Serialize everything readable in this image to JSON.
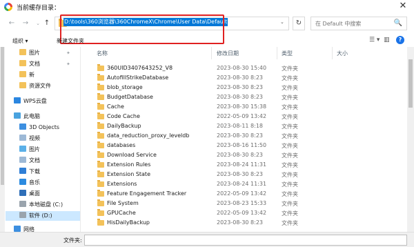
{
  "window": {
    "title": "当前缓存目录：",
    "close_glyph": "✕"
  },
  "nav": {
    "back_glyph": "←",
    "forward_glyph": "→",
    "dropdown_glyph": "⌄",
    "up_glyph": "↑",
    "refresh_glyph": "↻"
  },
  "address": {
    "path": "D:\\tools\\360浏览器\\360ChromeX\\Chrome\\User Data\\Default",
    "dropdown_glyph": "⌄"
  },
  "search": {
    "placeholder": "在 Default 中搜索",
    "icon_glyph": "🔍"
  },
  "toolbar": {
    "organize_label": "组织 ▾",
    "new_folder_label": "新建文件夹",
    "view_glyph": "☰ ▾",
    "pane_glyph": "▥",
    "help_glyph": "?"
  },
  "sidebar": {
    "items": [
      {
        "label": "图片",
        "pinned": true
      },
      {
        "label": "文档",
        "pinned": true
      },
      {
        "label": "新",
        "pinned": false
      },
      {
        "label": "资源文件",
        "pinned": false
      },
      {
        "label": "WPS云盘"
      },
      {
        "label": "此电脑"
      },
      {
        "label": "3D Objects"
      },
      {
        "label": "视频"
      },
      {
        "label": "图片"
      },
      {
        "label": "文档"
      },
      {
        "label": "下载"
      },
      {
        "label": "音乐"
      },
      {
        "label": "桌面"
      },
      {
        "label": "本地磁盘 (C:)"
      },
      {
        "label": "软件 (D:)"
      },
      {
        "label": "网络"
      }
    ],
    "pin_glyph": "✦"
  },
  "columns": {
    "name": "名称",
    "date": "修改日期",
    "type": "类型",
    "size": "大小"
  },
  "files": [
    {
      "name": "360UID3407643252_V8",
      "date": "2023-08-30 15:40",
      "type": "文件夹"
    },
    {
      "name": "AutofillStrikeDatabase",
      "date": "2023-08-30 8:23",
      "type": "文件夹"
    },
    {
      "name": "blob_storage",
      "date": "2023-08-30 8:23",
      "type": "文件夹"
    },
    {
      "name": "BudgetDatabase",
      "date": "2023-08-30 8:23",
      "type": "文件夹"
    },
    {
      "name": "Cache",
      "date": "2023-08-30 15:38",
      "type": "文件夹"
    },
    {
      "name": "Code Cache",
      "date": "2022-05-09 13:42",
      "type": "文件夹"
    },
    {
      "name": "DailyBackup",
      "date": "2023-08-11 8:18",
      "type": "文件夹"
    },
    {
      "name": "data_reduction_proxy_leveldb",
      "date": "2023-08-30 8:23",
      "type": "文件夹"
    },
    {
      "name": "databases",
      "date": "2023-08-16 11:50",
      "type": "文件夹"
    },
    {
      "name": "Download Service",
      "date": "2023-08-30 8:23",
      "type": "文件夹"
    },
    {
      "name": "Extension Rules",
      "date": "2023-08-24 11:31",
      "type": "文件夹"
    },
    {
      "name": "Extension State",
      "date": "2023-08-30 8:23",
      "type": "文件夹"
    },
    {
      "name": "Extensions",
      "date": "2023-08-24 11:31",
      "type": "文件夹"
    },
    {
      "name": "Feature Engagement Tracker",
      "date": "2022-05-09 13:42",
      "type": "文件夹"
    },
    {
      "name": "File System",
      "date": "2023-08-23 15:33",
      "type": "文件夹"
    },
    {
      "name": "GPUCache",
      "date": "2022-05-09 13:42",
      "type": "文件夹"
    },
    {
      "name": "HisDailyBackup",
      "date": "2023-08-30 8:23",
      "type": "文件夹"
    }
  ],
  "bottom": {
    "filename_label": "文件夹:",
    "filename_value": ""
  },
  "colors": {
    "selection": "#0078d7",
    "highlight_box": "#e02020",
    "folder": "#f3c25a"
  }
}
